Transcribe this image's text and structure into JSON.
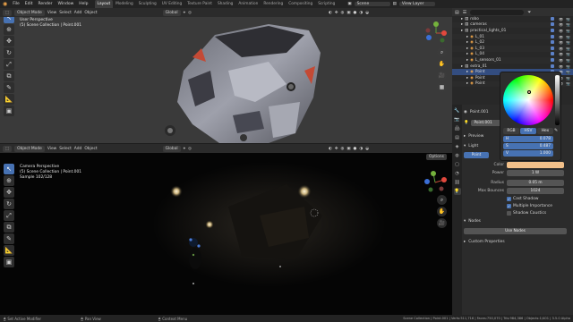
{
  "menu": {
    "items": [
      "File",
      "Edit",
      "Render",
      "Window",
      "Help"
    ],
    "workspaces": [
      "Layout",
      "Modeling",
      "Sculpting",
      "UV Editing",
      "Texture Paint",
      "Shading",
      "Animation",
      "Rendering",
      "Compositing",
      "Scripting"
    ],
    "active_workspace": "Layout",
    "scene_label": "Scene",
    "view_layer_label": "View Layer"
  },
  "top_viewport": {
    "mode": "Object Mode",
    "menus": [
      "View",
      "Select",
      "Add",
      "Object"
    ],
    "orientation": "Global",
    "info_line1": "User Perspective",
    "info_line2": "(5) Scene Collection | Point.001"
  },
  "bottom_viewport": {
    "mode": "Object Mode",
    "menus": [
      "View",
      "Select",
      "Add",
      "Object"
    ],
    "orientation": "Global",
    "options_label": "Options",
    "info_line1": "Camera Perspective",
    "info_line2": "(5) Scene Collection | Point.001",
    "info_line3": "Sample 102/128"
  },
  "outliner": {
    "rows": [
      {
        "label": "robo",
        "indent": 1,
        "selected": false
      },
      {
        "label": "cameras",
        "indent": 1,
        "selected": false
      },
      {
        "label": "practical_lights_01",
        "indent": 1,
        "selected": false
      },
      {
        "label": "L_01",
        "indent": 2,
        "selected": false
      },
      {
        "label": "L_02",
        "indent": 2,
        "selected": false
      },
      {
        "label": "L_03",
        "indent": 2,
        "selected": false
      },
      {
        "label": "L_04",
        "indent": 2,
        "selected": false
      },
      {
        "label": "L_sensors_01",
        "indent": 2,
        "selected": false
      },
      {
        "label": "extra_01",
        "indent": 1,
        "selected": false
      },
      {
        "label": "Point",
        "indent": 2,
        "selected": true
      },
      {
        "label": "Point",
        "indent": 2,
        "selected": false
      },
      {
        "label": "Point",
        "indent": 2,
        "selected": false
      }
    ]
  },
  "properties": {
    "object_name": "Point.001",
    "data_name": "Point.001",
    "preview_label": "Preview",
    "light_label": "Light",
    "light_type": "Point",
    "fields": {
      "color_label": "Color",
      "power_label": "Power",
      "power_value": "1 W",
      "radius_label": "Radius",
      "radius_value": "0.05 m",
      "max_bounces_label": "Max Bounces",
      "max_bounces_value": "1024"
    },
    "checkboxes": [
      {
        "label": "Cast Shadow",
        "checked": true
      },
      {
        "label": "Multiple Importance",
        "checked": true
      },
      {
        "label": "Shadow Caustics",
        "checked": false
      }
    ],
    "nodes_label": "Nodes",
    "use_nodes_label": "Use Nodes",
    "custom_props_label": "Custom Properties",
    "light_color": "#f2c08a"
  },
  "color_picker": {
    "modes": [
      "RGB",
      "HSV",
      "Hex"
    ],
    "active_mode": "HSV",
    "h_label": "H",
    "h_value": "0.078",
    "s_label": "S",
    "s_value": "0.487",
    "v_label": "V",
    "v_value": "1.000"
  },
  "statusbar": {
    "left1": "Set Active Modifier",
    "left2": "Pan View",
    "left3": "Context Menu",
    "right": "Scene Collection | Point.001 | Verts:511,716 | Faces:750,070 | Tris:984,386 | Objects:1/401 | 3.5.0 Alpha"
  },
  "colors": {
    "accent": "#4772b3",
    "selected_row": "#334d80",
    "active_tab_icon": "#f5a84a"
  }
}
